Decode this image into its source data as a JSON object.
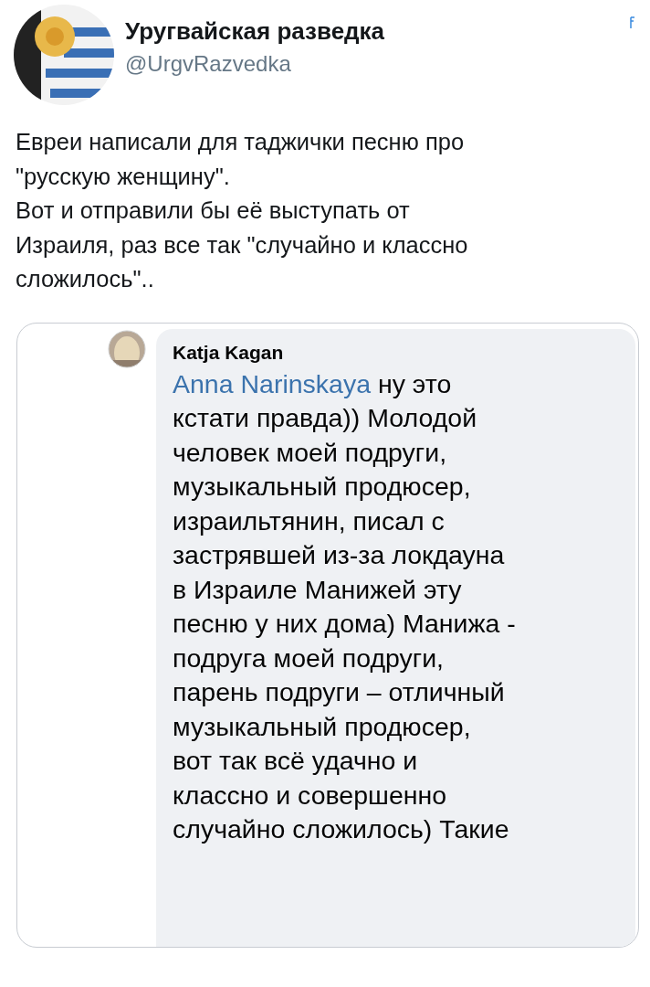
{
  "author": {
    "name": "Уругвайская разведка",
    "handle": "@UrgvRazvedka"
  },
  "tweet": {
    "lines": [
      "Евреи написали для таджички песню про",
      "\"русскую женщину\".",
      "Вот и отправили бы её выступать от",
      "Израиля, раз все так \"случайно и классно",
      "сложилось\".."
    ]
  },
  "comment": {
    "author": "Katja Kagan",
    "mention": "Anna Narinskaya",
    "lines": [
      "ну это",
      "кстати правда)) Молодой",
      "человек моей подруги,",
      "музыкальный продюсер,",
      "израильтянин, писал с",
      "застрявшей из-за локдауна",
      "в Израиле Манижей эту",
      "песню у них дома) Манижа -",
      "подруга моей подруги,",
      "парень подруги – отличный",
      "музыкальный  продюсер,",
      "вот так всё удачно и",
      "классно и совершенно",
      "случайно сложилось) Такие"
    ]
  }
}
